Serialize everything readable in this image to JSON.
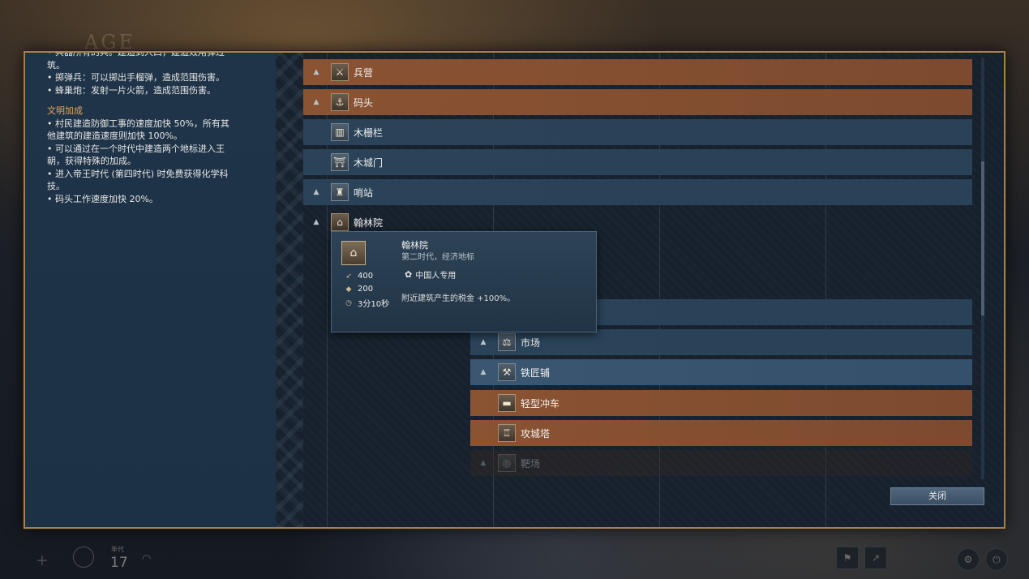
{
  "background": {
    "logo_text": "AGE",
    "hud": {
      "label_small": "年代",
      "number": "17"
    }
  },
  "left_panel": {
    "top_clipped": "• 兵器所有的兵。建造到人口，建造效用弹过",
    "top_lines": [
      "筑。",
      "• 掷弹兵：可以掷出手榴弹，造成范围伤害。",
      "• 蜂巢炮：发射一片火箭，造成范围伤害。"
    ],
    "civ_bonus_title": "文明加成",
    "civ_bonus_lines": [
      "• 村民建造防御工事的速度加快 50%，所有其",
      "他建筑的建造速度则加快 100%。",
      "• 可以通过在一个时代中建造两个地标进入王",
      "朝，获得特殊的加成。",
      "• 进入帝王时代 (第四时代) 时免费获得化学科",
      "技。",
      "• 码头工作速度加快 20%。"
    ]
  },
  "tree_rows": [
    {
      "label": "兵营",
      "icon": "crossed-swords-icon",
      "glyph": "⚔"
    },
    {
      "label": "码头",
      "icon": "anchor-icon",
      "glyph": "⚓"
    },
    {
      "label": "木栅栏",
      "icon": "palisade-icon",
      "glyph": "▥"
    },
    {
      "label": "木城门",
      "icon": "gate-icon",
      "glyph": "⛩"
    },
    {
      "label": "哨站",
      "icon": "outpost-icon",
      "glyph": "♜"
    },
    {
      "label": "翰林院",
      "icon": "imperial-academy-icon",
      "glyph": "⌂"
    },
    {
      "label": "市场",
      "icon": "scales-icon",
      "glyph": "⚖"
    },
    {
      "label": "铁匠铺",
      "icon": "anvil-icon",
      "glyph": "⚒"
    },
    {
      "label": "轻型冲车",
      "icon": "ram-icon",
      "glyph": "▬"
    },
    {
      "label": "攻城塔",
      "icon": "siege-tower-icon",
      "glyph": "♖"
    },
    {
      "label": "靶场",
      "icon": "target-icon",
      "glyph": "◎"
    }
  ],
  "tooltip": {
    "title": "翰林院",
    "subtitle": "第二时代，经济地标",
    "civ_text": "中国人专用",
    "costs": [
      {
        "icon": "wood-icon",
        "value": "400"
      },
      {
        "icon": "gold-icon",
        "value": "200"
      },
      {
        "icon": "time-icon",
        "value": "3分10秒"
      }
    ],
    "description": "附近建筑产生的税金 +100%。"
  },
  "close_button": "关闭",
  "colors": {
    "border_gold": "#a5804e",
    "row_orange": "#8a5332",
    "row_blue": "#2a4358",
    "section_title": "#e7a55b"
  }
}
